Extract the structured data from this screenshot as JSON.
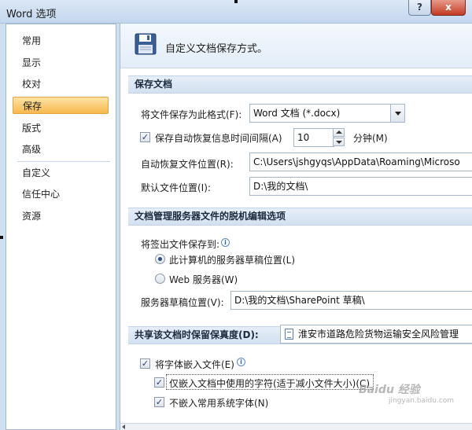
{
  "window": {
    "title": "Word 选项",
    "help_label": "?",
    "close_label": "x"
  },
  "sidebar": {
    "items": [
      {
        "label": "常用"
      },
      {
        "label": "显示"
      },
      {
        "label": "校对"
      },
      {
        "label": "保存",
        "active": true
      },
      {
        "label": "版式"
      },
      {
        "label": "高级"
      },
      {
        "label": "自定义"
      },
      {
        "label": "信任中心"
      },
      {
        "label": "资源"
      }
    ]
  },
  "header": {
    "text": "自定义文档保存方式。",
    "icon": "floppy-disk-icon"
  },
  "save_docs": {
    "title": "保存文档",
    "format_label": "将文件保存为此格式(F):",
    "format_value": "Word 文档 (*.docx)",
    "autorecover_label": "保存自动恢复信息时间间隔(A)",
    "autorecover_checked": true,
    "autorecover_value": "10",
    "minutes_label": "分钟(M)",
    "autorecover_location_label": "自动恢复文件位置(R):",
    "autorecover_location_value": "C:\\Users\\jshgyqs\\AppData\\Roaming\\Microso",
    "default_location_label": "默认文件位置(I):",
    "default_location_value": "D:\\我的文档\\"
  },
  "offline": {
    "title": "文档管理服务器文件的脱机编辑选项",
    "save_to_label": "将签出文件保存到:",
    "radio_local_label": "此计算机的服务器草稿位置(L)",
    "radio_local_selected": true,
    "radio_web_label": "Web 服务器(W)",
    "drafts_label": "服务器草稿位置(V):",
    "drafts_value": "D:\\我的文档\\SharePoint 草稿\\"
  },
  "fidelity": {
    "title": "共享该文档时保留保真度(D):",
    "doc_value": "淮安市道路危险货物运输安全风险管理",
    "embed_fonts_label": "将字体嵌入文件(E)",
    "embed_fonts_checked": true,
    "embed_used_label": "仅嵌入文档中使用的字符(适于减小文件大小)(C)",
    "embed_used_checked": true,
    "no_system_fonts_label": "不嵌入常用系统字体(N)",
    "no_system_fonts_checked": true
  },
  "watermark": {
    "brand": "Baidu 经验",
    "url": "jingyan.baidu.com"
  },
  "check_glyph": "✓",
  "info_glyph": "i",
  "colors": {
    "active_nav": "#f7b84e",
    "section_band": "#d3e1f1",
    "frame": "#cfe0f1"
  }
}
